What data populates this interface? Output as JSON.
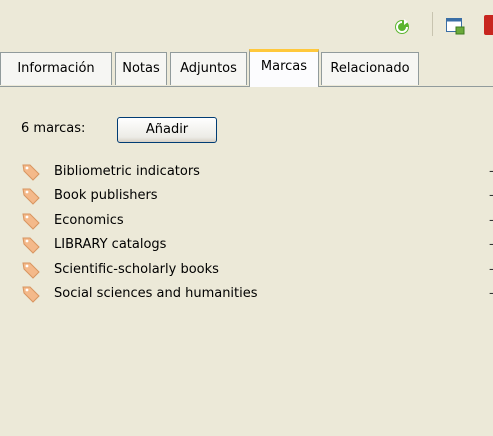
{
  "toolbar": {
    "refresh_icon": "refresh-icon",
    "window_icon": "new-window-icon",
    "close_icon": "close-red-icon"
  },
  "tabs": [
    {
      "label": "Información",
      "active": false
    },
    {
      "label": "Notas",
      "active": false
    },
    {
      "label": "Adjuntos",
      "active": false
    },
    {
      "label": "Marcas",
      "active": true
    },
    {
      "label": "Relacionado",
      "active": false
    }
  ],
  "tags_panel": {
    "count_label": "6 marcas:",
    "add_button": "Añadir",
    "tags": [
      {
        "label": "Bibliometric indicators",
        "icon": "tag-icon"
      },
      {
        "label": "Book publishers",
        "icon": "tag-icon"
      },
      {
        "label": "Economics",
        "icon": "tag-icon"
      },
      {
        "label": "LIBRARY catalogs",
        "icon": "tag-icon"
      },
      {
        "label": "Scientific-scholarly books",
        "icon": "tag-icon"
      },
      {
        "label": "Social sciences and humanities",
        "icon": "tag-icon"
      }
    ]
  },
  "colors": {
    "background": "#ece9d8",
    "active_tab_accent": "#ffc83c",
    "tag_icon": "#f4b98a"
  }
}
